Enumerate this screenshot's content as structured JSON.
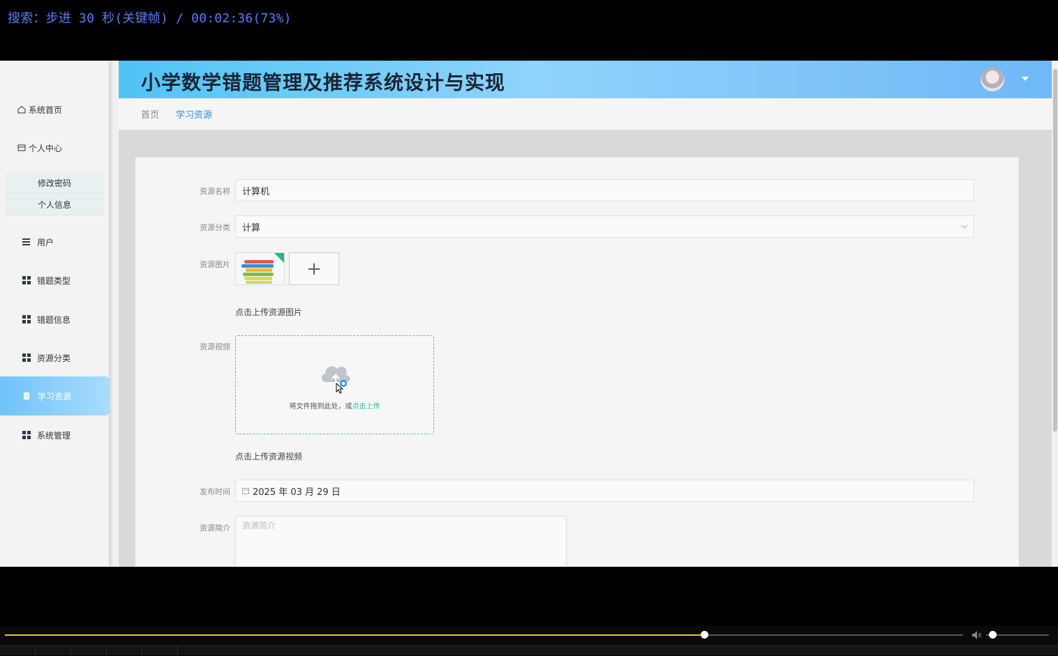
{
  "osd": {
    "text": "搜索：步进 30 秒(关键帧) / 00:02:36(73%)"
  },
  "header": {
    "title": "小学数学错题管理及推荐系统设计与实现"
  },
  "breadcrumb": {
    "home": "首页",
    "current": "学习资源"
  },
  "sidebar": {
    "items": [
      {
        "label": "系统首页",
        "icon": "home-icon"
      },
      {
        "label": "个人中心",
        "icon": "card-icon"
      },
      {
        "label": "修改密码"
      },
      {
        "label": "个人信息"
      },
      {
        "label": "用户",
        "icon": "list-icon"
      },
      {
        "label": "错题类型",
        "icon": "grid-icon"
      },
      {
        "label": "错题信息",
        "icon": "grid-icon"
      },
      {
        "label": "资源分类",
        "icon": "grid-icon"
      },
      {
        "label": "学习资源",
        "icon": "doc-icon"
      },
      {
        "label": "系统管理",
        "icon": "grid-icon"
      }
    ],
    "active_color": "#6fc3f7"
  },
  "form": {
    "name_label": "资源名称",
    "name_value": "计算机",
    "category_label": "资源分类",
    "category_value": "计算",
    "image_label": "资源图片",
    "image_hint": "点击上传资源图片",
    "video_label": "资源视频",
    "drop_text": "将文件拖到此处，或",
    "drop_link": "点击上传",
    "video_hint": "点击上传资源视频",
    "date_label": "发布时间",
    "date_value": "2025 年 03 月 29 日",
    "intro_label": "资源简介",
    "intro_placeholder": "资源简介"
  },
  "player": {
    "progress": 0.73,
    "volume": 0.1,
    "accent": "#e5c82a"
  }
}
